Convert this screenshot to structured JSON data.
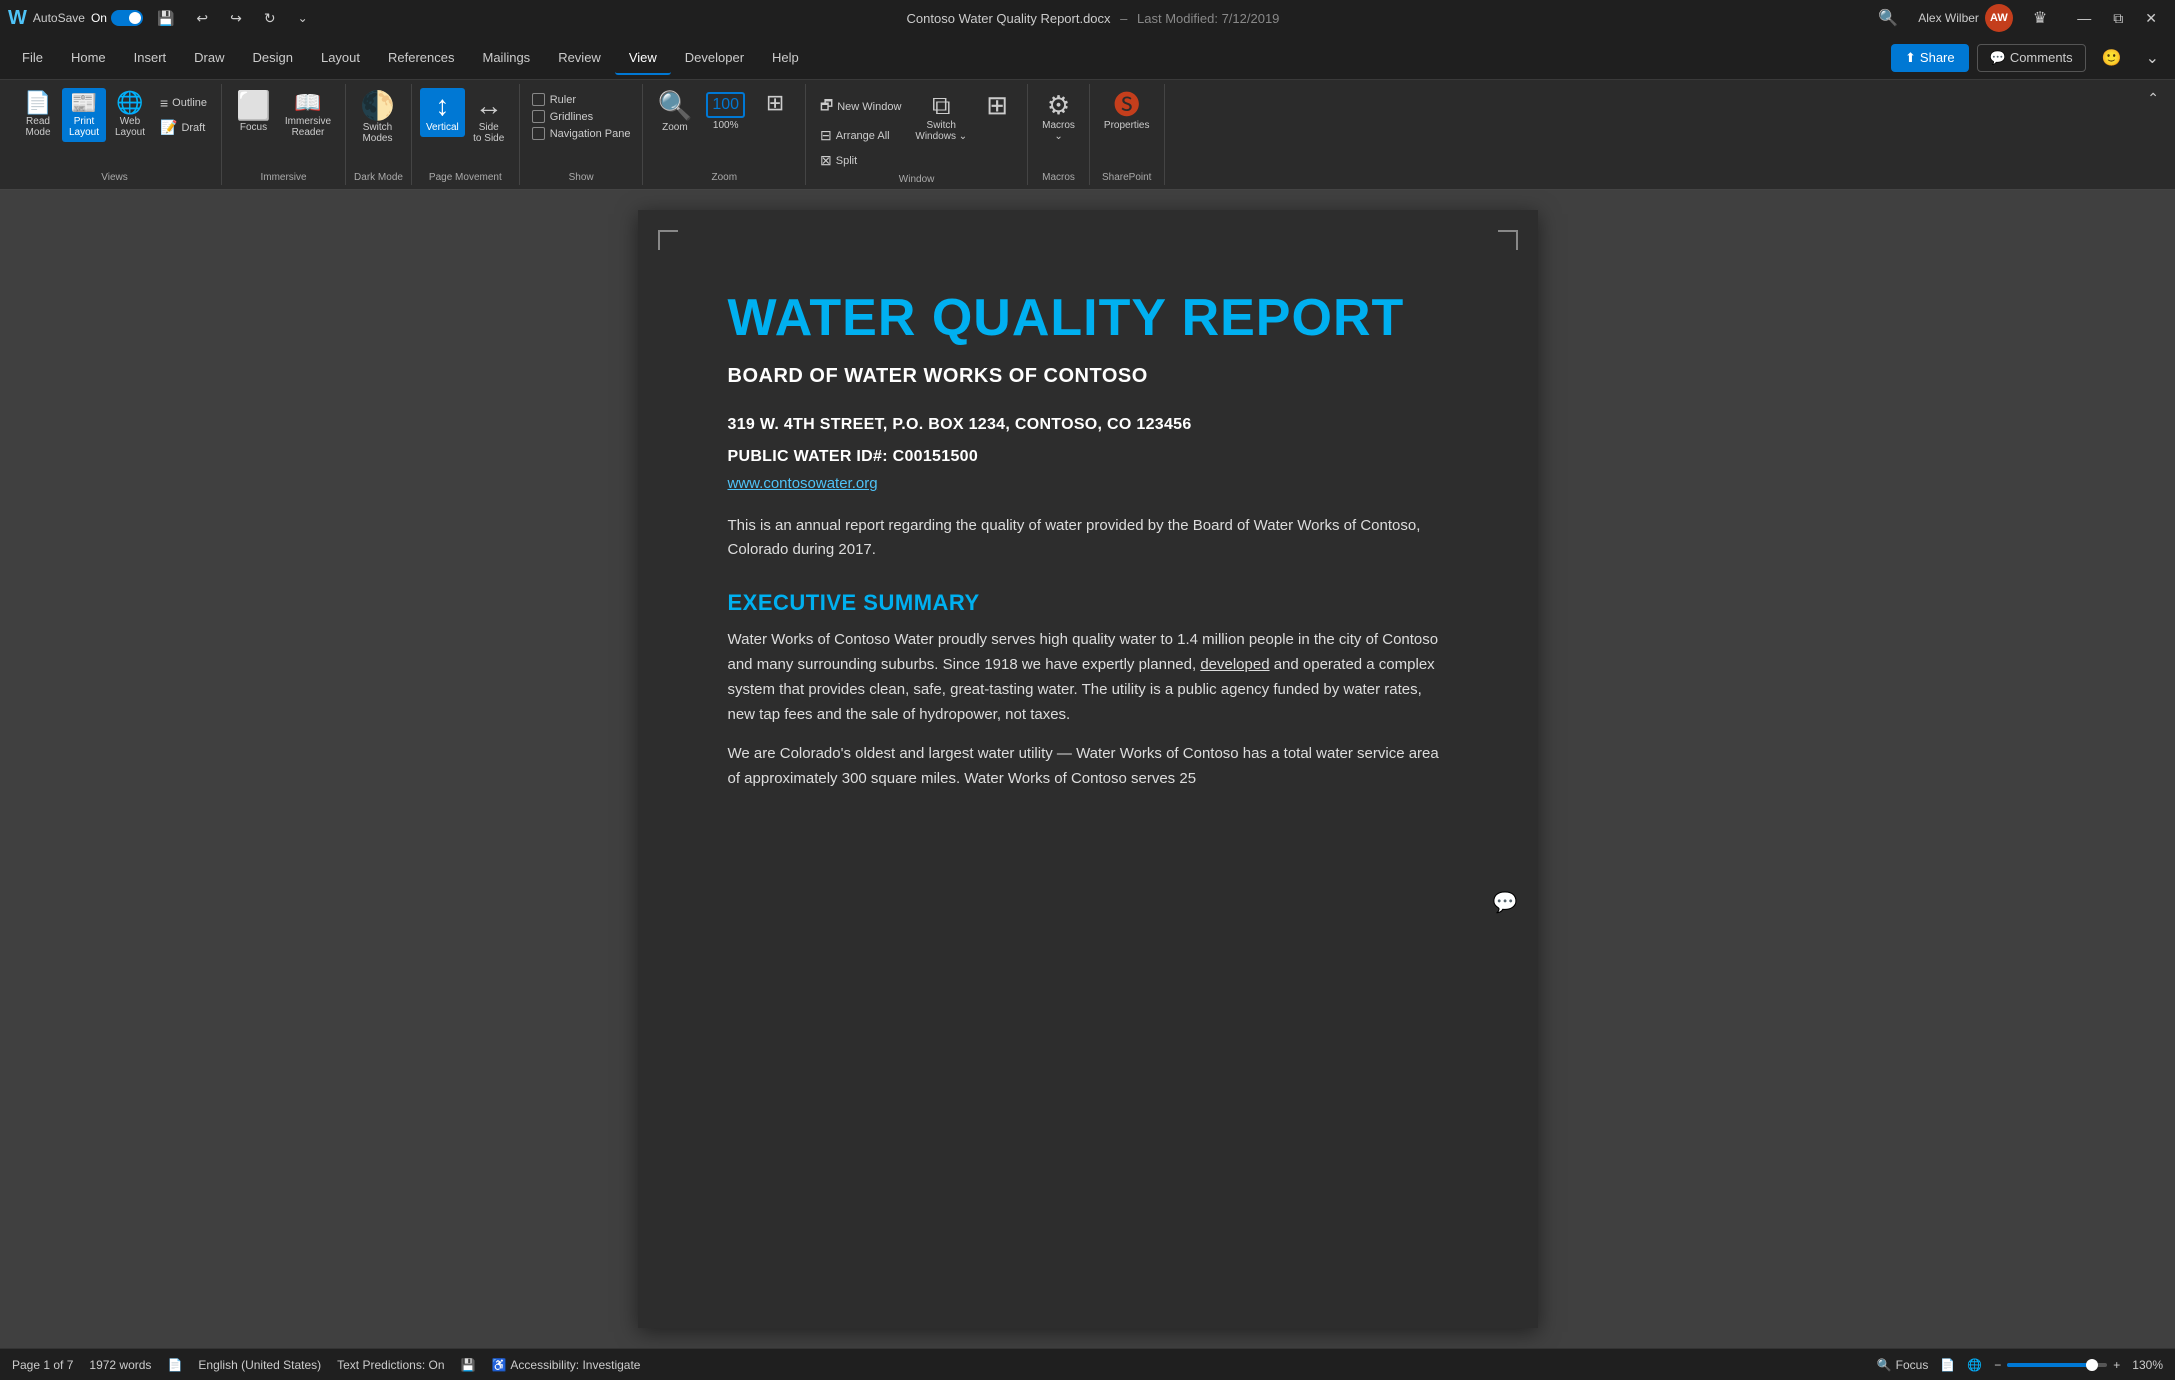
{
  "titlebar": {
    "autosave": "AutoSave",
    "on_label": "On",
    "file_name": "Contoso Water Quality Report.docx",
    "last_modified": "Last Modified: 7/12/2019",
    "user_name": "Alex Wilber",
    "user_initials": "AW"
  },
  "ribbon_tabs": {
    "tabs": [
      "File",
      "Home",
      "Insert",
      "Draw",
      "Design",
      "Layout",
      "References",
      "Mailings",
      "Review",
      "View",
      "Developer",
      "Help"
    ],
    "active_tab": "View",
    "share_label": "Share",
    "comments_label": "Comments"
  },
  "ribbon": {
    "groups": {
      "views": {
        "label": "Views",
        "buttons": [
          {
            "id": "read-mode",
            "label": "Read\nMode",
            "icon": "📄"
          },
          {
            "id": "print-layout",
            "label": "Print\nLayout",
            "icon": "📰"
          },
          {
            "id": "web-layout",
            "label": "Web\nLayout",
            "icon": "🌐"
          }
        ],
        "small_buttons": [
          {
            "id": "outline",
            "label": "Outline"
          },
          {
            "id": "draft",
            "label": "Draft"
          }
        ]
      },
      "immersive": {
        "label": "Immersive",
        "buttons": [
          {
            "id": "focus",
            "label": "Focus",
            "icon": "⬜"
          },
          {
            "id": "immersive-reader",
            "label": "Immersive\nReader",
            "icon": "📖"
          },
          {
            "id": "switch-modes",
            "label": "Switch\nModes",
            "icon": "🌓"
          }
        ]
      },
      "dark_mode": {
        "label": "Dark Mode",
        "buttons": [
          {
            "id": "switch-modes-dark",
            "label": "Switch\nModes",
            "icon": "🌓"
          }
        ]
      },
      "page_movement": {
        "label": "Page Movement",
        "buttons": [
          {
            "id": "vertical",
            "label": "Vertical",
            "icon": "↕"
          },
          {
            "id": "side-to-side",
            "label": "Side\nto Side",
            "icon": "↔"
          }
        ]
      },
      "show": {
        "label": "Show",
        "checkboxes": [
          {
            "id": "ruler",
            "label": "Ruler",
            "checked": false
          },
          {
            "id": "gridlines",
            "label": "Gridlines",
            "checked": false
          },
          {
            "id": "navigation-pane",
            "label": "Navigation Pane",
            "checked": false
          }
        ]
      },
      "zoom": {
        "label": "Zoom",
        "zoom_label": "Zoom",
        "zoom_percent": "100%",
        "zoom_pages": "⊞"
      },
      "window": {
        "label": "Window",
        "buttons": [
          {
            "id": "new-window",
            "label": "New Window"
          },
          {
            "id": "arrange-all",
            "label": "Arrange All"
          },
          {
            "id": "split",
            "label": "Split"
          },
          {
            "id": "switch-windows",
            "label": "Switch\nWindows"
          },
          {
            "id": "view-side-by-side",
            "label": ""
          }
        ]
      },
      "macros": {
        "label": "Macros",
        "buttons": [
          {
            "id": "macros-btn",
            "label": "Macros"
          }
        ]
      },
      "sharepoint": {
        "label": "SharePoint",
        "buttons": [
          {
            "id": "properties-btn",
            "label": "Properties"
          }
        ]
      }
    }
  },
  "document": {
    "title": "WATER QUALITY REPORT",
    "subtitle": "BOARD OF WATER WORKS OF CONTOSO",
    "address_line1": "319 W. 4TH STREET, P.O. BOX 1234, CONTOSO, CO 123456",
    "address_line2": "PUBLIC WATER ID#: C00151500",
    "website": "www.contosowater.org",
    "intro_text": "This is an annual report regarding the quality of water provided by the Board of Water Works of Contoso, Colorado during 2017.",
    "section1_title": "EXECUTIVE SUMMARY",
    "section1_para1": "Water Works of Contoso Water proudly serves high quality water to 1.4 million people in the city of Contoso and many surrounding suburbs. Since 1918 we have expertly planned, developed and operated a complex system that provides clean, safe, great-tasting water. The utility is a public agency funded by water rates, new tap fees and the sale of hydropower, not taxes.",
    "section1_para2": "We are Colorado's oldest and largest water utility — Water Works of Contoso has a total water service area of approximately 300 square miles. Water Works of Contoso serves 25"
  },
  "statusbar": {
    "page": "Page 1 of 7",
    "words": "1972 words",
    "language": "English (United States)",
    "text_predictions": "Text Predictions: On",
    "accessibility": "Accessibility: Investigate",
    "focus_label": "Focus",
    "zoom_percent": "130%",
    "layout_label": "Print Layout",
    "web_layout_label": "Web Layout"
  },
  "icons": {
    "undo": "↩",
    "redo": "↪",
    "save": "💾",
    "search": "🔍",
    "share": "↑",
    "comment": "💬",
    "smiley": "🙂",
    "minimize": "—",
    "restore": "⧉",
    "close": "✕",
    "crown": "♛",
    "grid": "⊞",
    "pages": "⊡",
    "ruler": "📏",
    "shield": "🛡"
  }
}
